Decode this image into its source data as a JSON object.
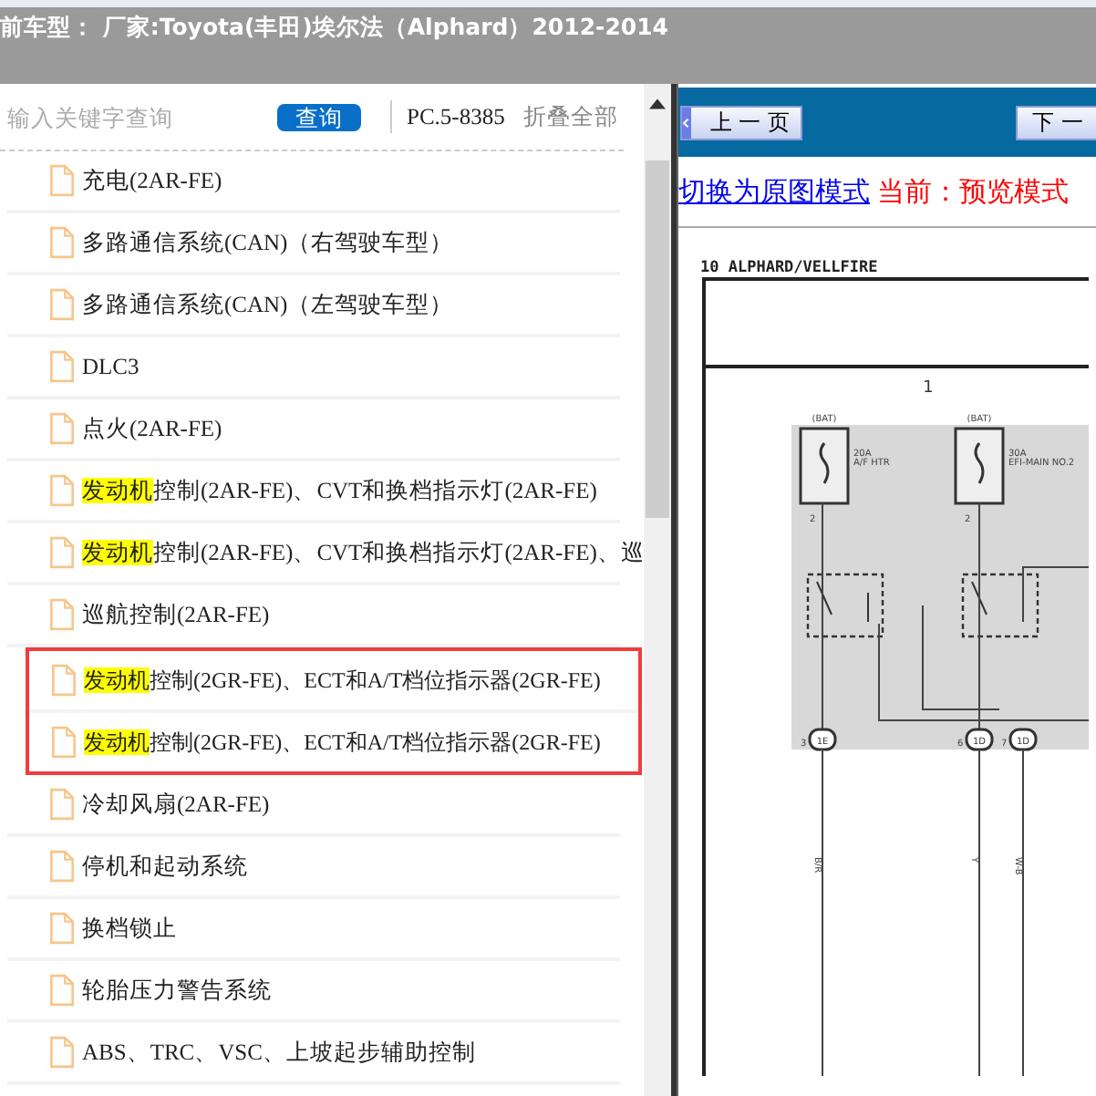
{
  "header": {
    "title": "前车型： 厂家:Toyota(丰田)埃尔法（Alphard）2012-2014"
  },
  "search": {
    "placeholder": "输入关键字查询",
    "button": "查询",
    "code": "PC.5-8385",
    "collapse": "折叠全部"
  },
  "list": [
    {
      "kind": "item",
      "text": "充电(2AR-FE)"
    },
    {
      "kind": "item",
      "text": "多路通信系统(CAN)（右驾驶车型）"
    },
    {
      "kind": "item",
      "text": "多路通信系统(CAN)（左驾驶车型）"
    },
    {
      "kind": "item",
      "text": "DLC3"
    },
    {
      "kind": "item",
      "text": "点火(2AR-FE)"
    },
    {
      "kind": "item",
      "highlight": "发动机",
      "text": "控制(2AR-FE)、CVT和换档指示灯(2AR-FE)"
    },
    {
      "kind": "item",
      "highlight": "发动机",
      "text": "控制(2AR-FE)、CVT和换档指示灯(2AR-FE)、巡"
    },
    {
      "kind": "item",
      "text": "巡航控制(2AR-FE)"
    },
    {
      "kind": "frame",
      "items": [
        {
          "highlight": "发动机",
          "text": "控制(2GR-FE)、ECT和A/T档位指示器(2GR-FE)"
        },
        {
          "highlight": "发动机",
          "text": "控制(2GR-FE)、ECT和A/T档位指示器(2GR-FE)"
        }
      ]
    },
    {
      "kind": "item",
      "text": "冷却风扇(2AR-FE)"
    },
    {
      "kind": "item",
      "text": "停机和起动系统"
    },
    {
      "kind": "item",
      "text": "换档锁止"
    },
    {
      "kind": "item",
      "text": "轮胎压力警告系统"
    },
    {
      "kind": "item",
      "text": "ABS、TRC、VSC、上坡起步辅助控制"
    }
  ],
  "viewer": {
    "prev": "上 一 页",
    "next": "下 一",
    "switch_link": "切换为原图模式",
    "mode": "当前：预览模式"
  },
  "schematic": {
    "title": "10 ALPHARD/VELLFIRE",
    "column": "1",
    "fuses": [
      {
        "source": "(BAT)",
        "rating": "20A",
        "name": "A/F HTR",
        "pin": "2"
      },
      {
        "source": "(BAT)",
        "rating": "30A",
        "name": "EFI-MAIN NO.2",
        "pin": "2"
      }
    ],
    "connectors": [
      {
        "pin": "3",
        "code": "1E",
        "wire": "B/R"
      },
      {
        "pin": "6",
        "code": "1D",
        "wire": "Y"
      },
      {
        "pin": "7",
        "code": "1D",
        "wire": "W-B"
      }
    ]
  }
}
